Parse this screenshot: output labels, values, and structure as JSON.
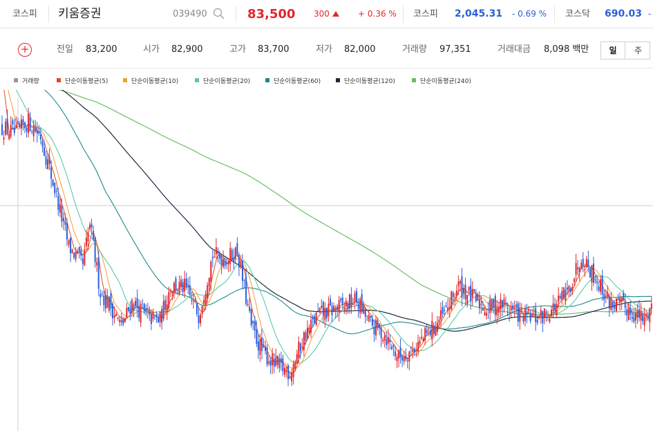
{
  "header": {
    "market": "코스피",
    "name": "키움증권",
    "code": "039490",
    "price": "83,500",
    "change": "300",
    "change_rate": "+ 0.36 %",
    "kospi_label": "코스피",
    "kospi_value": "2,045.31",
    "kospi_rate": "- 0.69 %",
    "kosdaq_label": "코스닥",
    "kosdaq_value": "690.03",
    "kosdaq_rate": "-"
  },
  "summary": {
    "prev_label": "전일",
    "prev_value": "83,200",
    "open_label": "시가",
    "open_value": "82,900",
    "high_label": "고가",
    "high_value": "83,700",
    "low_label": "저가",
    "low_value": "82,000",
    "volume_label": "거래량",
    "volume_value": "97,351",
    "amount_label": "거래대금",
    "amount_value": "8,098 백만",
    "period_day": "일",
    "period_week": "주"
  },
  "colors": {
    "up": "#e0262d",
    "down": "#2b5fd9",
    "ma5": "#e8452c",
    "ma10": "#f0a030",
    "ma20": "#5cc8a8",
    "ma60": "#1a8a8a",
    "ma120": "#1c2a40",
    "ma240": "#6abf62"
  },
  "icons": {
    "search": "search-icon",
    "add": "plus-circle-icon",
    "arrow": "up-triangle-icon"
  },
  "chart_data": {
    "type": "candlestick",
    "legend": [
      {
        "name": "거래량",
        "color": "#999999"
      },
      {
        "name": "단순이동평균(5)",
        "color": "#e8452c"
      },
      {
        "name": "단순이동평균(10)",
        "color": "#f0a030"
      },
      {
        "name": "단순이동평균(20)",
        "color": "#5cc8a8"
      },
      {
        "name": "단순이동평균(60)",
        "color": "#1a8a8a"
      },
      {
        "name": "단순이동평균(120)",
        "color": "#1c2a40"
      },
      {
        "name": "단순이동평균(240)",
        "color": "#6abf62"
      }
    ],
    "reference_price": 83200,
    "ylim": [
      73500,
      88500
    ],
    "close_trend": [
      [
        0,
        87000
      ],
      [
        8,
        86700
      ],
      [
        15,
        87300
      ],
      [
        22,
        86600
      ],
      [
        30,
        84000
      ],
      [
        38,
        81200
      ],
      [
        46,
        80300
      ],
      [
        50,
        82300
      ],
      [
        56,
        79000
      ],
      [
        62,
        78300
      ],
      [
        68,
        77300
      ],
      [
        74,
        78500
      ],
      [
        82,
        77800
      ],
      [
        90,
        77600
      ],
      [
        96,
        79300
      ],
      [
        104,
        79200
      ],
      [
        112,
        77900
      ],
      [
        120,
        80800
      ],
      [
        128,
        80600
      ],
      [
        134,
        81000
      ],
      [
        142,
        77300
      ],
      [
        148,
        76100
      ],
      [
        156,
        75400
      ],
      [
        164,
        75100
      ],
      [
        172,
        76800
      ],
      [
        180,
        77900
      ],
      [
        188,
        78100
      ],
      [
        194,
        78300
      ],
      [
        202,
        78600
      ],
      [
        210,
        77400
      ],
      [
        218,
        76900
      ],
      [
        226,
        75800
      ],
      [
        234,
        76200
      ],
      [
        244,
        77100
      ],
      [
        252,
        77900
      ],
      [
        260,
        79300
      ],
      [
        268,
        78700
      ],
      [
        276,
        78200
      ],
      [
        286,
        78400
      ],
      [
        296,
        77800
      ],
      [
        306,
        77700
      ],
      [
        314,
        78200
      ],
      [
        322,
        78900
      ],
      [
        330,
        80800
      ],
      [
        338,
        79700
      ],
      [
        346,
        78500
      ],
      [
        356,
        78200
      ],
      [
        366,
        77600
      ],
      [
        370,
        78400
      ]
    ]
  }
}
